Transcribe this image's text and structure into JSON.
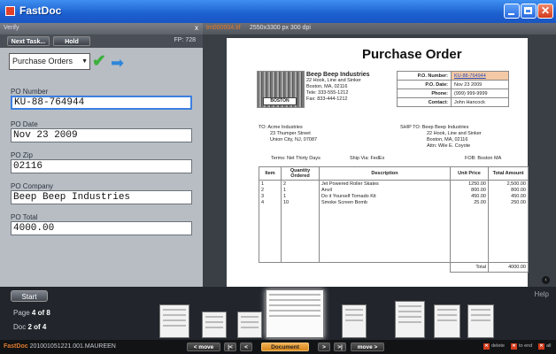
{
  "window": {
    "title": "FastDoc"
  },
  "verify": {
    "label": "Verify",
    "close": "x"
  },
  "task_bar": {
    "next_task": "Next Task...",
    "hold": "Hold",
    "fp": "FP: 728"
  },
  "doc_type": {
    "selected": "Purchase Orders"
  },
  "fields": [
    {
      "label": "PO Number",
      "value": "KU-88-764944"
    },
    {
      "label": "PO Date",
      "value": "Nov 23 2009"
    },
    {
      "label": "PO Zip",
      "value": "02116"
    },
    {
      "label": "PO Company",
      "value": "Beep Beep Industries"
    },
    {
      "label": "PO Total",
      "value": "4000.00"
    }
  ],
  "doc_header": {
    "filename": "tm000004.tif",
    "dims": "2550x3300 px  300 dpi"
  },
  "po": {
    "title": "Purchase Order",
    "logo_text": "BOSTON",
    "company": {
      "name": "Beep Beep Industries",
      "line1": "22 Hook, Line and Sinker",
      "line2": "Boston, MA, 02116",
      "line3": "Tele: 333-555-1212",
      "line4": "Fax: 833-444-1212"
    },
    "meta": [
      {
        "k": "P.O. Number:",
        "v": "KU-88-764944"
      },
      {
        "k": "P.O. Date:",
        "v": "Nov 23 2009"
      },
      {
        "k": "Phone:",
        "v": "(999) 999-9999"
      },
      {
        "k": "Contact:",
        "v": "John Hancock"
      }
    ],
    "to": {
      "label": "TO:",
      "line1": "Acme Industries",
      "line2": "23 Thumper Street",
      "line3": "Union City, NJ, 07087"
    },
    "ship_to": {
      "label": "SHIP TO:",
      "line1": "Beep Beep Industries",
      "line2": "22 Hook, Line and Sinker",
      "line3": "Boston, MA, 02116",
      "line4": "Attn: Wile E. Coyote"
    },
    "terms": "Terms:  Net Thirty Days",
    "ship_via": "Ship Via:  FedEx",
    "fob": "FOB: Boston MA",
    "headers": {
      "item": "Item",
      "qty": "Quantity Ordered",
      "desc": "Description",
      "price": "Unit Price",
      "amount": "Total Amount"
    },
    "items": [
      {
        "item": "1",
        "qty": "2",
        "desc": "Jet Powered Roller Skates",
        "price": "1250.00",
        "amount": "2,500.00"
      },
      {
        "item": "2",
        "qty": "1",
        "desc": "Anvil",
        "price": "800.00",
        "amount": "800.00"
      },
      {
        "item": "3",
        "qty": "1",
        "desc": "Do it Yourself Tornado Kit",
        "price": "450.00",
        "amount": "450.00"
      },
      {
        "item": "4",
        "qty": "10",
        "desc": "Smoke Screen Bomb",
        "price": "25.00",
        "amount": "250.00"
      }
    ],
    "total_label": "Total",
    "total_value": "4000.00"
  },
  "bottom": {
    "start": "Start",
    "help": "Help",
    "page_label": "Page",
    "page_value": "4 of 8",
    "doc_label": "Doc",
    "doc_value": "2 of 4"
  },
  "status": {
    "brand": "FastDoc",
    "job": "201001051221.001.MAUREEN",
    "move_left": "< move",
    "first": "|<",
    "prev": "<",
    "document": "Document",
    "next": ">",
    "last": ">|",
    "move_right": "move >",
    "delete": "delete",
    "to_end": "to end",
    "all": "all"
  }
}
